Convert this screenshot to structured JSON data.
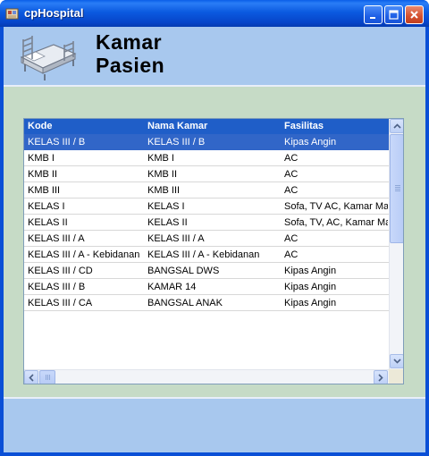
{
  "window": {
    "title": "cpHospital"
  },
  "header": {
    "title_line1": "Kamar",
    "title_line2": "Pasien"
  },
  "listview": {
    "columns": [
      "Kode",
      "Nama Kamar",
      "Fasilitas"
    ],
    "rows": [
      {
        "kode": "KELAS  III / B",
        "nama": "KELAS  III / B",
        "fasilitas": "Kipas Angin",
        "selected": true
      },
      {
        "kode": "KMB  I",
        "nama": "KMB  I",
        "fasilitas": "AC"
      },
      {
        "kode": "KMB II",
        "nama": "KMB II",
        "fasilitas": "AC"
      },
      {
        "kode": "KMB III",
        "nama": "KMB III",
        "fasilitas": "AC"
      },
      {
        "kode": "KELAS  I",
        "nama": "KELAS I",
        "fasilitas": "Sofa, TV AC, Kamar Mandi"
      },
      {
        "kode": "KELAS  II",
        "nama": "KELAS II",
        "fasilitas": "Sofa, TV, AC, Kamar Mandi"
      },
      {
        "kode": "KELAS  III / A",
        "nama": "KELAS  III / A",
        "fasilitas": "AC"
      },
      {
        "kode": "KELAS  III / A - Kebidanan",
        "nama": "KELAS  III / A - Kebidanan",
        "fasilitas": "AC"
      },
      {
        "kode": "KELAS  III / CD",
        "nama": "BANGSAL DWS",
        "fasilitas": "Kipas Angin"
      },
      {
        "kode": "KELAS  III / B",
        "nama": "KAMAR 14",
        "fasilitas": "Kipas Angin"
      },
      {
        "kode": "KELAS  III / CA",
        "nama": "BANGSAL ANAK",
        "fasilitas": "Kipas Angin"
      }
    ]
  },
  "icons": {
    "app": "hospital-app-icon",
    "header": "hospital-bed-icon",
    "minimize": "minimize-icon",
    "maximize": "maximize-icon",
    "close": "close-icon"
  },
  "colors": {
    "titlebar": "#0a5ee8",
    "header_band": "#a8c8ee",
    "client_bg": "#c6dbc6",
    "list_header": "#1f5ec8",
    "selection": "#3166c8"
  }
}
